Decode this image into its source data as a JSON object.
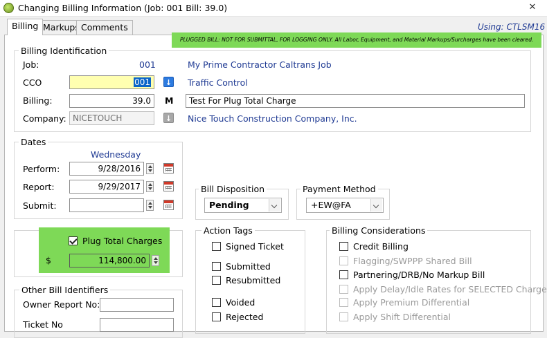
{
  "window": {
    "title": "Changing Billing Information  (Job: 001  Bill:  39.0)",
    "close_glyph": "✕"
  },
  "tabs": [
    {
      "label": "Billing"
    },
    {
      "label": "Markups"
    },
    {
      "label": "Comments"
    }
  ],
  "using_label": "Using: CTLSM16",
  "banner": "PLUGGED BILL: NOT FOR SUBMITTAL, FOR LOGGING ONLY. All Labor, Equipment, and Material Markups/Surcharges have been cleared.",
  "billing_identification": {
    "legend": "Billing Identification",
    "job_label": "Job:",
    "job_value": "001",
    "job_desc": "My Prime Contractor Caltrans Job",
    "cco_label": "CCO",
    "cco_value": "001",
    "cco_desc": "Traffic Control",
    "billing_label": "Billing:",
    "billing_value": "39.0",
    "billing_flag": "M",
    "billing_desc": "Test For Plug Total Charge",
    "company_label": "Company:",
    "company_value": "NICETOUCH",
    "company_desc": "Nice Touch Construction Company, Inc."
  },
  "dates": {
    "legend": "Dates",
    "weekday": "Wednesday",
    "perform_label": "Perform:",
    "perform_value": "9/28/2016",
    "report_label": "Report:",
    "report_value": "9/29/2017",
    "submit_label": "Submit:",
    "submit_value": ""
  },
  "bill_disposition": {
    "legend": "Bill Disposition",
    "selected": "Pending"
  },
  "payment_method": {
    "legend": "Payment Method",
    "selected": "+EW@FA"
  },
  "plug": {
    "label": "Plug Total Charges",
    "checked": true,
    "currency": "$",
    "value": "114,800.00"
  },
  "other_identifiers": {
    "legend": "Other Bill Identifiers",
    "owner_report_label": "Owner Report No:",
    "owner_report_value": "",
    "ticket_label": "Ticket No",
    "ticket_value": ""
  },
  "action_tags": {
    "legend": "Action Tags",
    "items": [
      {
        "label": "Signed Ticket"
      },
      {
        "label": "Submitted"
      },
      {
        "label": "Resubmitted"
      },
      {
        "label": "Voided"
      },
      {
        "label": "Rejected"
      }
    ]
  },
  "billing_considerations": {
    "legend": "Billing Considerations",
    "items": [
      {
        "label": "Credit Billing",
        "enabled": true
      },
      {
        "label": "Flagging/SWPPP Shared Bill",
        "enabled": false
      },
      {
        "label": "Partnering/DRB/No Markup Bill",
        "enabled": true
      },
      {
        "label": "Apply Delay/Idle Rates for SELECTED Charges",
        "enabled": false
      },
      {
        "label": "Apply Premium Differential",
        "enabled": false
      },
      {
        "label": "Apply Shift Differential",
        "enabled": false
      }
    ]
  },
  "colors": {
    "highlight_green": "#7ed957",
    "link_blue": "#1f3a93",
    "cco_yellow": "#ffffb0"
  }
}
